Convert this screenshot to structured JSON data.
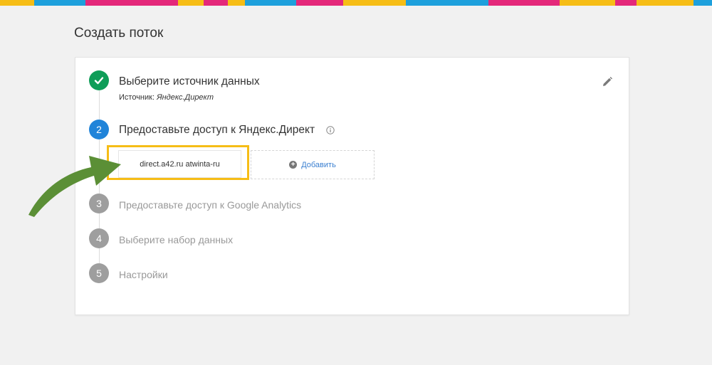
{
  "page": {
    "title": "Создать поток"
  },
  "steps": [
    {
      "number": "",
      "status": "done",
      "title": "Выберите источник данных",
      "subtitle_label": "Источник:",
      "subtitle_value": "Яндекс.Директ"
    },
    {
      "number": "2",
      "status": "active",
      "title": "Предоставьте доступ к Яндекс.Директ"
    },
    {
      "number": "3",
      "status": "pending",
      "title": "Предоставьте доступ к Google Analytics"
    },
    {
      "number": "4",
      "status": "pending",
      "title": "Выберите набор данных"
    },
    {
      "number": "5",
      "status": "pending",
      "title": "Настройки"
    }
  ],
  "access": {
    "account_label": "direct.a42.ru atwinta-ru",
    "add_label": "Добавить"
  },
  "colors": {
    "done": "#0f9d58",
    "active": "#2184d9",
    "pending": "#9e9e9e",
    "highlight": "#f6bd16",
    "arrow": "#5b8f36",
    "link": "#3a7fd0"
  },
  "icons": {
    "edit": "pencil-icon",
    "info": "info-icon",
    "done": "check-icon",
    "add": "plus-circle-icon"
  }
}
